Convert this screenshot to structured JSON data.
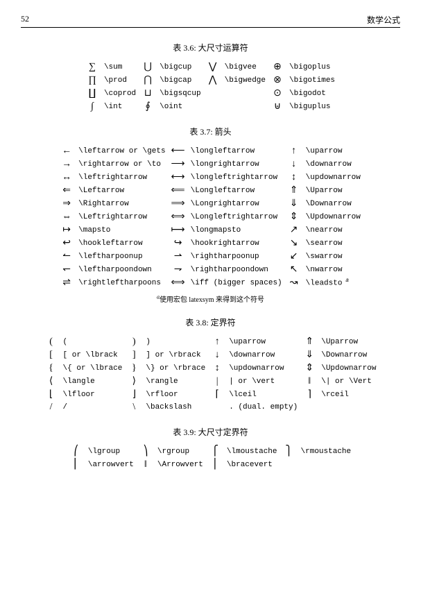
{
  "page_number": "52",
  "header_title": "数学公式",
  "tables": {
    "t36": {
      "caption": "表 3.6: 大尺寸运算符",
      "rows": [
        [
          [
            "∑",
            "\\sum"
          ],
          [
            "⋃",
            "\\bigcup"
          ],
          [
            "⋁",
            "\\bigvee"
          ],
          [
            "⊕",
            "\\bigoplus"
          ]
        ],
        [
          [
            "∏",
            "\\prod"
          ],
          [
            "⋂",
            "\\bigcap"
          ],
          [
            "⋀",
            "\\bigwedge"
          ],
          [
            "⊗",
            "\\bigotimes"
          ]
        ],
        [
          [
            "∐",
            "\\coprod"
          ],
          [
            "⊔",
            "\\bigsqcup"
          ],
          [
            "",
            ""
          ],
          [
            "⊙",
            "\\bigodot"
          ]
        ],
        [
          [
            "∫",
            "\\int"
          ],
          [
            "∮",
            "\\oint"
          ],
          [
            "",
            ""
          ],
          [
            "⊎",
            "\\biguplus"
          ]
        ]
      ]
    },
    "t37": {
      "caption": "表 3.7: 箭头",
      "rows": [
        [
          [
            "←",
            "\\leftarrow or \\gets"
          ],
          [
            "⟵",
            "\\longleftarrow"
          ],
          [
            "↑",
            "\\uparrow"
          ]
        ],
        [
          [
            "→",
            "\\rightarrow or \\to"
          ],
          [
            "⟶",
            "\\longrightarrow"
          ],
          [
            "↓",
            "\\downarrow"
          ]
        ],
        [
          [
            "↔",
            "\\leftrightarrow"
          ],
          [
            "⟷",
            "\\longleftrightarrow"
          ],
          [
            "↕",
            "\\updownarrow"
          ]
        ],
        [
          [
            "⇐",
            "\\Leftarrow"
          ],
          [
            "⟸",
            "\\Longleftarrow"
          ],
          [
            "⇑",
            "\\Uparrow"
          ]
        ],
        [
          [
            "⇒",
            "\\Rightarrow"
          ],
          [
            "⟹",
            "\\Longrightarrow"
          ],
          [
            "⇓",
            "\\Downarrow"
          ]
        ],
        [
          [
            "⇔",
            "\\Leftrightarrow"
          ],
          [
            "⟺",
            "\\Longleftrightarrow"
          ],
          [
            "⇕",
            "\\Updownarrow"
          ]
        ],
        [
          [
            "↦",
            "\\mapsto"
          ],
          [
            "⟼",
            "\\longmapsto"
          ],
          [
            "↗",
            "\\nearrow"
          ]
        ],
        [
          [
            "↩",
            "\\hookleftarrow"
          ],
          [
            "↪",
            "\\hookrightarrow"
          ],
          [
            "↘",
            "\\searrow"
          ]
        ],
        [
          [
            "↼",
            "\\leftharpoonup"
          ],
          [
            "⇀",
            "\\rightharpoonup"
          ],
          [
            "↙",
            "\\swarrow"
          ]
        ],
        [
          [
            "↽",
            "\\leftharpoondown"
          ],
          [
            "⇁",
            "\\rightharpoondown"
          ],
          [
            "↖",
            "\\nwarrow"
          ]
        ],
        [
          [
            "⇌",
            "\\rightleftharpoons"
          ],
          [
            "⟺",
            "\\iff (bigger spaces)"
          ],
          [
            "↝",
            "\\leadsto"
          ]
        ]
      ],
      "footnote_mark": "a",
      "footnote": "使用宏包 latexsym 来得到这个符号"
    },
    "t38": {
      "caption": "表 3.8: 定界符",
      "rows": [
        [
          [
            "(",
            "("
          ],
          [
            ")",
            ")"
          ],
          [
            "↑",
            "\\uparrow"
          ],
          [
            "⇑",
            "\\Uparrow"
          ]
        ],
        [
          [
            "[",
            "[ or \\lbrack"
          ],
          [
            "]",
            "] or \\rbrack"
          ],
          [
            "↓",
            "\\downarrow"
          ],
          [
            "⇓",
            "\\Downarrow"
          ]
        ],
        [
          [
            "{",
            "\\{ or \\lbrace"
          ],
          [
            "}",
            "\\} or \\rbrace"
          ],
          [
            "↕",
            "\\updownarrow"
          ],
          [
            "⇕",
            "\\Updownarrow"
          ]
        ],
        [
          [
            "⟨",
            "\\langle"
          ],
          [
            "⟩",
            "\\rangle"
          ],
          [
            "|",
            "| or \\vert"
          ],
          [
            "‖",
            "\\| or \\Vert"
          ]
        ],
        [
          [
            "⌊",
            "\\lfloor"
          ],
          [
            "⌋",
            "\\rfloor"
          ],
          [
            "⌈",
            "\\lceil"
          ],
          [
            "⌉",
            "\\rceil"
          ]
        ],
        [
          [
            "/",
            "/"
          ],
          [
            "\\",
            "\\backslash"
          ],
          [
            "",
            ". (dual. empty)"
          ],
          [
            "",
            ""
          ]
        ]
      ]
    },
    "t39": {
      "caption": "表 3.9: 大尺寸定界符",
      "rows": [
        [
          [
            "⎛",
            "\\lgroup"
          ],
          [
            "⎞",
            "\\rgroup"
          ],
          [
            "⎧",
            "\\lmoustache"
          ],
          [
            "⎫",
            "\\rmoustache"
          ]
        ],
        [
          [
            "⎢",
            "\\arrowvert"
          ],
          [
            "‖",
            "\\Arrowvert"
          ],
          [
            "⎪",
            "\\bracevert"
          ],
          [
            "",
            ""
          ]
        ]
      ]
    }
  }
}
